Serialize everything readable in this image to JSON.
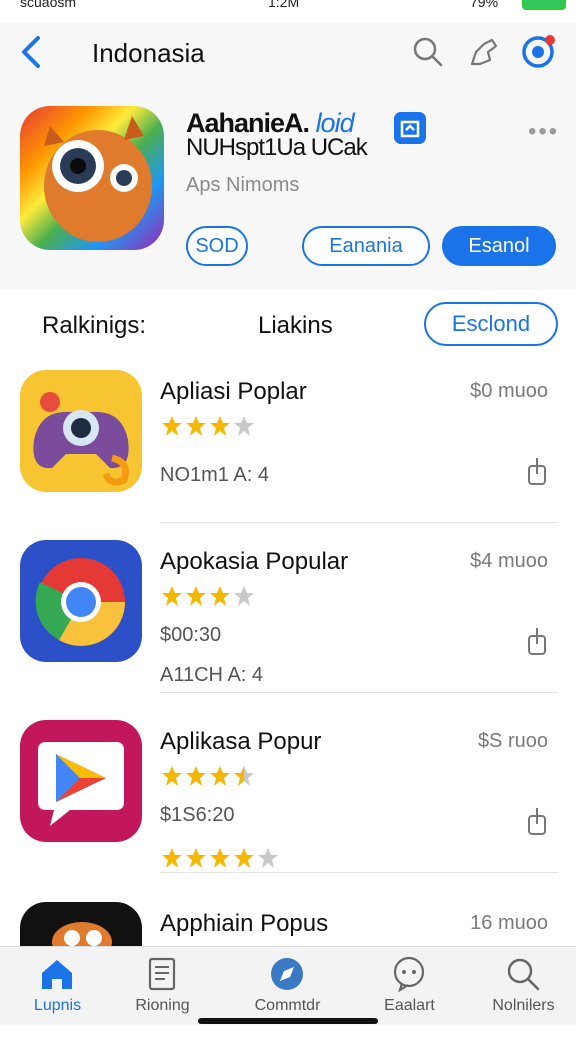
{
  "status": {
    "left": "scuaosm",
    "time": "1:2M",
    "battery": "79%"
  },
  "nav": {
    "title": "Indonasia"
  },
  "hero": {
    "title": "AahanieA.",
    "title_link": "loid",
    "subtitle": "NUHspt1Ua UCak",
    "category": "Aps Nimoms",
    "btn1": "SOD",
    "btn2": "Eanania",
    "btn3": "Esanol"
  },
  "section": {
    "tab1": "Ralkinigs:",
    "tab2": "Liakins",
    "button": "Esclond"
  },
  "apps": [
    {
      "name": "Apliasi Poplar",
      "price": "$0 muoo",
      "rating": 3,
      "meta1": "NO1m1 A: 4",
      "meta2": "",
      "colors": [
        "#f9c23c",
        "#f39c12"
      ]
    },
    {
      "name": "Apokasia Popular",
      "price": "$4 muoo",
      "rating": 3,
      "meta1": "$00:30",
      "meta2": "A11CH A: 4",
      "colors": [
        "#2b50c8",
        "#3f5fd6"
      ]
    },
    {
      "name": "Aplikasa Popur",
      "price": "$S ruoo",
      "rating": 3.5,
      "meta1": "$1S6:20",
      "meta2": "",
      "rating2": 4,
      "colors": [
        "#c2185b",
        "#e91e63"
      ]
    },
    {
      "name": "Apphiain Popus",
      "price": "16 muoo",
      "rating": 0,
      "meta1": "",
      "meta2": "",
      "colors": [
        "#111111",
        "#222222"
      ]
    }
  ],
  "tabs": [
    {
      "label": "Lupnis",
      "icon": "home-icon",
      "active": true
    },
    {
      "label": "Rioning",
      "icon": "document-icon",
      "active": false
    },
    {
      "label": "Commtdr",
      "icon": "compass-icon",
      "active": false
    },
    {
      "label": "Eaalart",
      "icon": "chat-icon",
      "active": false
    },
    {
      "label": "Nolnilers",
      "icon": "search-icon",
      "active": false
    }
  ],
  "colors": {
    "accent": "#1a73e8",
    "star": "#f5b800",
    "star_empty": "#c9c9c9"
  }
}
